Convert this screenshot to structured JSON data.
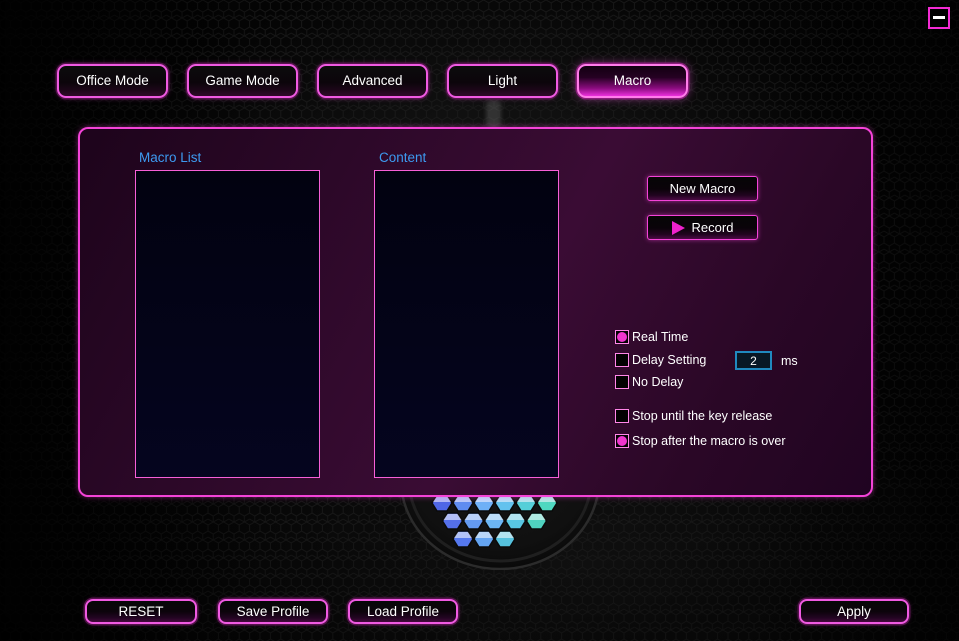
{
  "window": {
    "icons": {
      "minimize": "minus-bar",
      "record_play": "triangle-right"
    }
  },
  "tabs": [
    {
      "label": "Office Mode",
      "selected": false
    },
    {
      "label": "Game Mode",
      "selected": false
    },
    {
      "label": "Advanced",
      "selected": false
    },
    {
      "label": "Light",
      "selected": false
    },
    {
      "label": "Macro",
      "selected": true
    }
  ],
  "macro_panel": {
    "macro_list_label": "Macro List",
    "content_label": "Content",
    "macro_list_items": [],
    "content_items": [],
    "new_macro_button": "New Macro",
    "record_button": "Record",
    "playback_options": [
      {
        "label": "Real Time",
        "selected": true
      },
      {
        "label": "Delay Setting",
        "selected": false
      },
      {
        "label": "No Delay",
        "selected": false
      }
    ],
    "delay_input_value": "2",
    "delay_input_unit": "ms",
    "stop_options": [
      {
        "label": "Stop until the key release",
        "selected": false
      },
      {
        "label": "Stop after the macro is over",
        "selected": true
      }
    ]
  },
  "footer_buttons": {
    "reset": "RESET",
    "save_profile": "Save Profile",
    "load_profile": "Load Profile",
    "apply": "Apply"
  },
  "colors": {
    "accent_magenta": "#f443d8",
    "selected_tab_glow": "#ea2fdb",
    "section_label_blue": "#3d9af0",
    "listbox_bg": "#04041a",
    "input_border_teal": "#2089c0",
    "radio_dot": "#ef35cd",
    "mouse_hex_rows": [
      [
        "#4f66e6",
        "#5f8cf0",
        "#6fb0f6",
        "#63c2ee",
        "#55cfd8",
        "#4fd8c0"
      ],
      [
        "#5570ea",
        "#649af2",
        "#6cb6f4",
        "#58c6e2",
        "#4fd2bf"
      ],
      [
        "#5578ee",
        "#64a4f2",
        "#56c2de"
      ]
    ]
  }
}
